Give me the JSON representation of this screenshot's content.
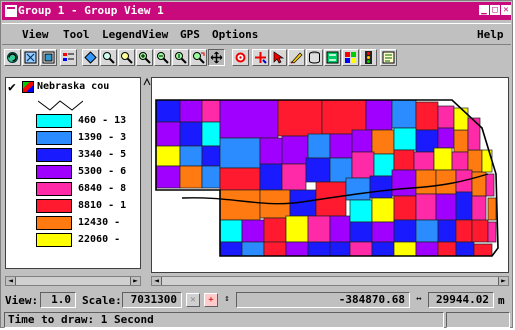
{
  "window": {
    "title": "Group 1 - Group View 1",
    "title_bar_color": "#c80a7c"
  },
  "menu": {
    "items": [
      "View",
      "Tool",
      "LegendView",
      "GPS",
      "Options"
    ],
    "help": "Help"
  },
  "toolbar": {
    "icons": [
      "redraw-icon",
      "full-view-icon",
      "window-icon",
      "legend-icon",
      "diamond-select-icon",
      "zoom-box-icon",
      "zoom-zoom-icon",
      "zoom-in-icon",
      "zoom-out-icon",
      "zoom-1x-icon",
      "zoom-back-icon",
      "pan-icon",
      "measure-icon",
      "gps-icon",
      "select-icon",
      "sketch-icon",
      "database-icon",
      "swap-icon",
      "color-icon",
      "traffic-light-icon",
      "script-icon"
    ],
    "active_icon": "pan-icon"
  },
  "legend": {
    "layer_name": "Nebraska cou",
    "items": [
      {
        "label": "460 - 13",
        "color": "#00ffff"
      },
      {
        "label": "1390 - 3",
        "color": "#2a8cff"
      },
      {
        "label": "3340 - 5",
        "color": "#1a1aff"
      },
      {
        "label": "5300 - 6",
        "color": "#a000ff"
      },
      {
        "label": "6840 - 8",
        "color": "#ff2aa8"
      },
      {
        "label": "8810 - 1",
        "color": "#ff1a30"
      },
      {
        "label": "12430 -",
        "color": "#ff7a10"
      },
      {
        "label": "22060 -",
        "color": "#ffff00"
      }
    ]
  },
  "status": {
    "view_label": "View:",
    "view_value": "1.0",
    "scale_label": "Scale:",
    "scale_value": "7031300",
    "x_value": "-384870.68",
    "y_value": "29944.02",
    "unit": "m"
  },
  "message": "Time to draw: 1 Second"
}
